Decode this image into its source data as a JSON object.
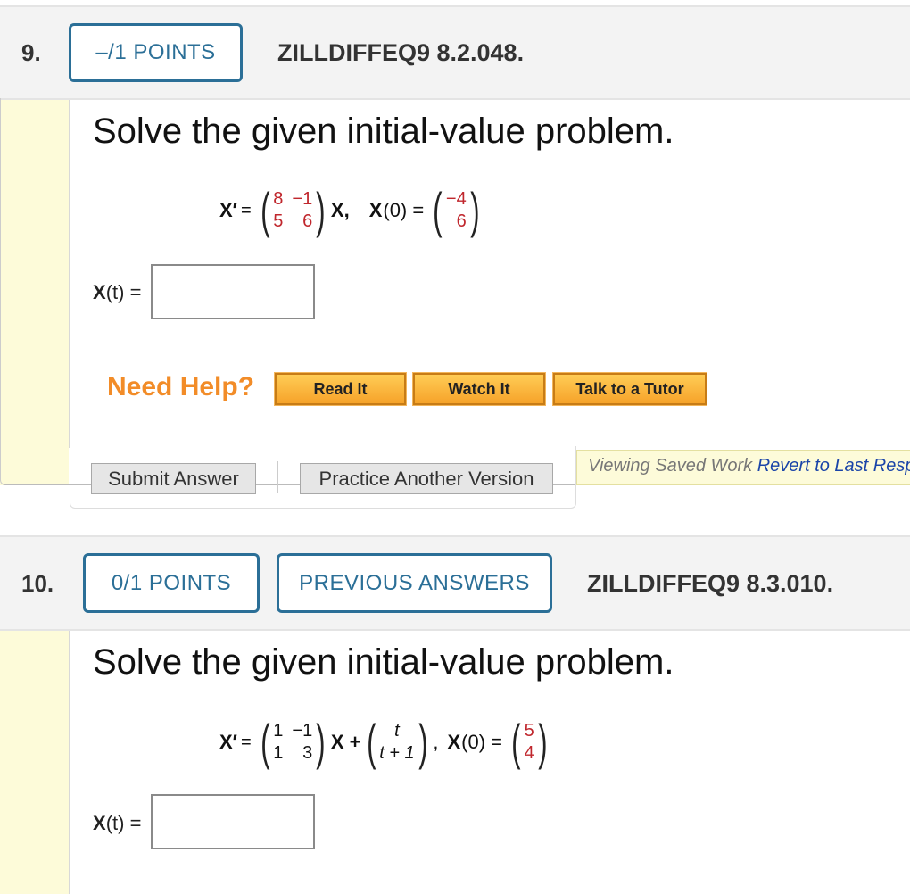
{
  "q9": {
    "number": "9.",
    "points": "–/1 POINTS",
    "code": "ZILLDIFFEQ9 8.2.048.",
    "prompt": "Solve the given initial-value problem.",
    "eq": {
      "lhs": "X′",
      "eqsign": "=",
      "matrix": [
        [
          "8",
          "−1"
        ],
        [
          "5",
          "6"
        ]
      ],
      "x_after": "X,",
      "x0_label": "X",
      "x0_arg": "(0) =",
      "x0_vec": [
        "−4",
        "6"
      ]
    },
    "answer_label_x": "X",
    "answer_label_t": "(t) =",
    "answer_value": "",
    "need_help": "Need Help?",
    "help_buttons": [
      "Read It",
      "Watch It",
      "Talk to a Tutor"
    ],
    "submit": "Submit Answer",
    "practice": "Practice Another Version",
    "saved_text": "Viewing Saved Work",
    "revert_text": "Revert to Last Response"
  },
  "q10": {
    "number": "10.",
    "points": "0/1 POINTS",
    "previous": "PREVIOUS ANSWERS",
    "code": "ZILLDIFFEQ9 8.3.010.",
    "prompt": "Solve the given initial-value problem.",
    "eq": {
      "lhs": "X′",
      "eqsign": "=",
      "matrix": [
        [
          "1",
          "−1"
        ],
        [
          "1",
          "3"
        ]
      ],
      "x_plus": "X +",
      "forcing": [
        "t",
        "t + 1"
      ],
      "comma": ",",
      "x0_label": "X",
      "x0_arg": "(0) =",
      "x0_vec": [
        "5",
        "4"
      ]
    },
    "answer_label_x": "X",
    "answer_label_t": "(t) =",
    "answer_value": ""
  }
}
